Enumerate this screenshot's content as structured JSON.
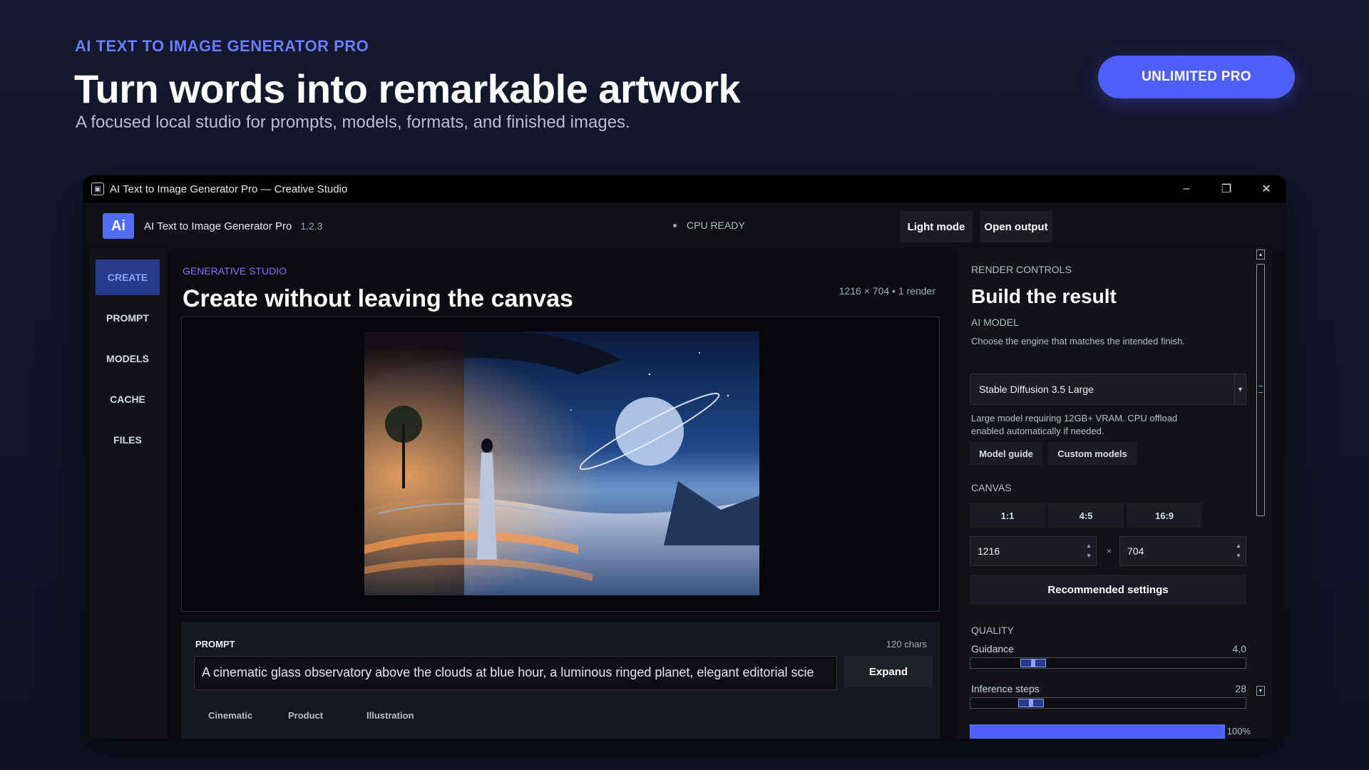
{
  "hero": {
    "eyebrow": "AI TEXT TO IMAGE GENERATOR PRO",
    "title": "Turn words into remarkable artwork",
    "subtitle": "A focused local studio for prompts, models, formats, and finished images.",
    "cta_label": "UNLIMITED PRO"
  },
  "window": {
    "title": "AI Text to Image Generator Pro — Creative Studio",
    "controls": {
      "minimize": "–",
      "restore": "❐",
      "close": "✕"
    }
  },
  "appbar": {
    "logo": "Ai",
    "app_name": "AI Text to Image Generator Pro",
    "version": "1.2.3",
    "status": "CPU READY",
    "light_mode_label": "Light mode",
    "open_output_label": "Open output"
  },
  "sidebar": {
    "items": [
      {
        "label": "CREATE",
        "active": true
      },
      {
        "label": "PROMPT",
        "active": false
      },
      {
        "label": "MODELS",
        "active": false
      },
      {
        "label": "CACHE",
        "active": false
      },
      {
        "label": "FILES",
        "active": false
      }
    ]
  },
  "main": {
    "eyebrow": "GENERATIVE STUDIO",
    "title": "Create without leaving the canvas",
    "canvas_meta": "1216 × 704 • 1 render",
    "prompt": {
      "label": "PROMPT",
      "count": "120 chars",
      "value": "A cinematic glass observatory above the clouds at blue hour, a luminous ringed planet, elegant editorial scie",
      "expand_label": "Expand",
      "styles": [
        "Cinematic",
        "Product",
        "Illustration"
      ]
    }
  },
  "render_controls": {
    "eyebrow": "RENDER CONTROLS",
    "title": "Build the result",
    "model_section": {
      "label": "AI MODEL",
      "description": "Choose the engine that matches the intended finish.",
      "selected_model": "Stable Diffusion 3.5 Large",
      "model_note": "Large model requiring 12GB+ VRAM. CPU offload enabled automatically if needed.",
      "model_guide_label": "Model guide",
      "custom_models_label": "Custom models"
    },
    "canvas_section": {
      "label": "CANVAS",
      "ratios": [
        "1:1",
        "4:5",
        "16:9"
      ],
      "width": "1216",
      "height": "704",
      "times": "×",
      "recommended_label": "Recommended settings"
    },
    "quality_section": {
      "label": "QUALITY",
      "guidance_label": "Guidance",
      "guidance_value": "4.0",
      "guidance_fraction": 0.2,
      "steps_label": "Inference steps",
      "steps_value": "28",
      "steps_fraction": 0.19
    },
    "progress_fraction": 1.0,
    "progress_label": "100%"
  },
  "colors": {
    "accent": "#4f5ef5",
    "accent_light": "#8ea0ff",
    "eyebrow_purple": "#8b6cff",
    "background": "#111528"
  }
}
